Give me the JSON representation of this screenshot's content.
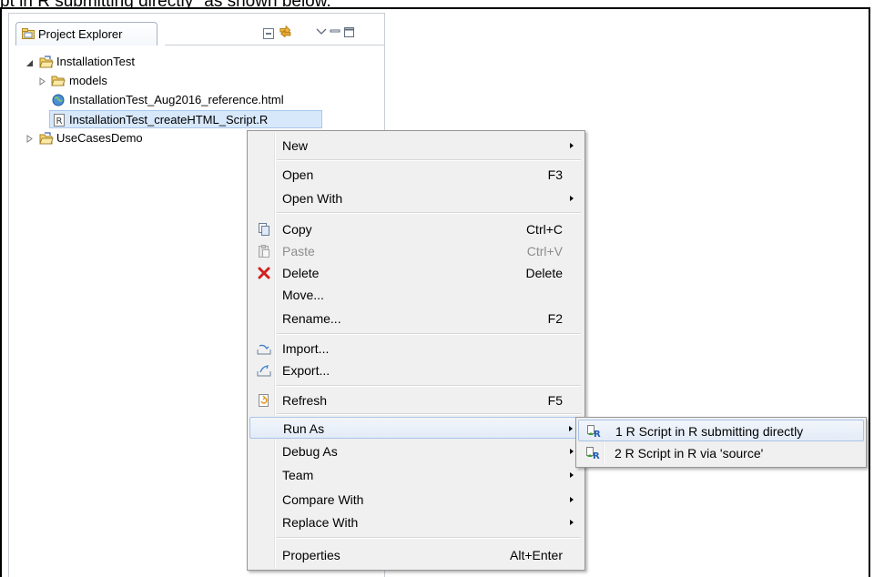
{
  "caption": "pt in R submitting directly\" as shown below.",
  "view": {
    "title": "Project Explorer"
  },
  "toolbar": {
    "icons": [
      "collapse-all-icon",
      "link-with-editor-icon",
      "view-menu-icon",
      "minimize-icon",
      "maximize-icon"
    ]
  },
  "tree": {
    "items": [
      {
        "label": "InstallationTest",
        "icon": "project-open-icon",
        "expanded": true
      },
      {
        "label": "models",
        "icon": "folder-icon",
        "expanded": false
      },
      {
        "label": "InstallationTest_Aug2016_reference.html",
        "icon": "html-file-icon"
      },
      {
        "label": "InstallationTest_createHTML_Script.R",
        "icon": "r-file-icon",
        "selected": true
      },
      {
        "label": "UseCasesDemo",
        "icon": "project-icon",
        "expanded": false
      }
    ]
  },
  "menu": {
    "items": [
      {
        "label": "New",
        "submenu": true
      },
      {
        "label": "Open",
        "accel": "F3"
      },
      {
        "label": "Open With",
        "submenu": true
      },
      {
        "label": "Copy",
        "accel": "Ctrl+C",
        "icon": "copy-icon"
      },
      {
        "label": "Paste",
        "accel": "Ctrl+V",
        "icon": "paste-icon",
        "disabled": true
      },
      {
        "label": "Delete",
        "accel": "Delete",
        "icon": "delete-icon"
      },
      {
        "label": "Move..."
      },
      {
        "label": "Rename...",
        "accel": "F2"
      },
      {
        "label": "Import...",
        "icon": "import-icon"
      },
      {
        "label": "Export...",
        "icon": "export-icon"
      },
      {
        "label": "Refresh",
        "accel": "F5",
        "icon": "refresh-icon"
      },
      {
        "label": "Run As",
        "submenu": true,
        "highlighted": true
      },
      {
        "label": "Debug As",
        "submenu": true
      },
      {
        "label": "Team",
        "submenu": true
      },
      {
        "label": "Compare With",
        "submenu": true
      },
      {
        "label": "Replace With",
        "submenu": true
      },
      {
        "label": "Properties",
        "accel": "Alt+Enter"
      }
    ]
  },
  "submenu": {
    "items": [
      {
        "label": "1 R Script in R submitting directly",
        "icon": "r-launch-icon",
        "highlighted": true
      },
      {
        "label": "2 R Script in R via 'source'",
        "icon": "r-launch-icon"
      }
    ]
  },
  "colors": {
    "selection": "#d8e8fb",
    "highlight_border": "#a8c4e6",
    "menu_bg": "#f0f0f0",
    "delete_red": "#d22020"
  }
}
